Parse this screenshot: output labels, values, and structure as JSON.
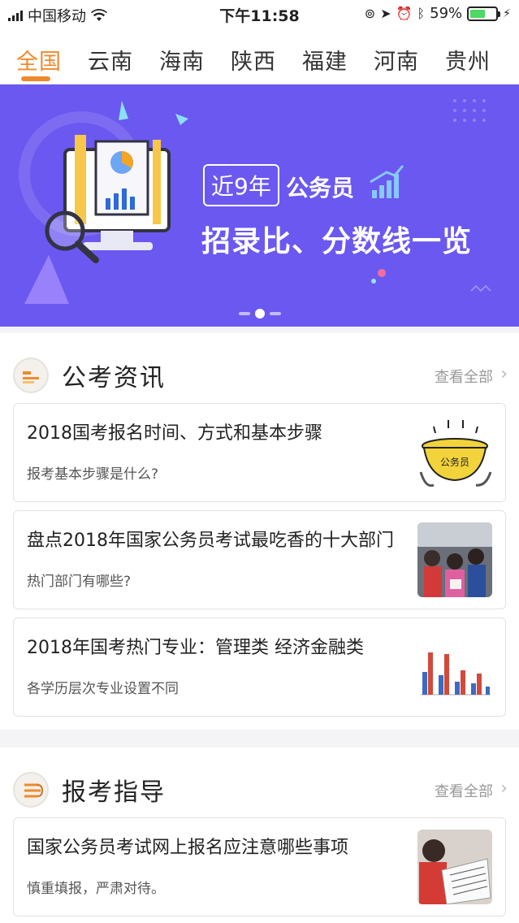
{
  "status": {
    "carrier": "中国移动",
    "time": "下午11:58",
    "battery": "59%"
  },
  "tabs": [
    "全国",
    "云南",
    "海南",
    "陕西",
    "福建",
    "河南",
    "贵州"
  ],
  "banner": {
    "tag1": "近9年",
    "tag2": "公务员",
    "headline": "招录比、分数线一览"
  },
  "news": {
    "title": "公考资讯",
    "more": "查看全部",
    "items": [
      {
        "title": "2018国考报名时间、方式和基本步骤",
        "sub": "报考基本步骤是什么?",
        "thumb_text": "公务员"
      },
      {
        "title": "盘点2018年国家公务员考试最吃香的十大部门",
        "sub": "热门部门有哪些?"
      },
      {
        "title": "2018年国考热门专业：管理类 经济金融类",
        "sub": "各学历层次专业设置不同"
      }
    ]
  },
  "guide": {
    "title": "报考指导",
    "more": "查看全部",
    "items": [
      {
        "title": "国家公务员考试网上报名应注意哪些事项",
        "sub": "慎重填报，严肃对待。"
      }
    ]
  },
  "colors": {
    "accent": "#f0892b",
    "banner_bg": "#6b58f0"
  }
}
